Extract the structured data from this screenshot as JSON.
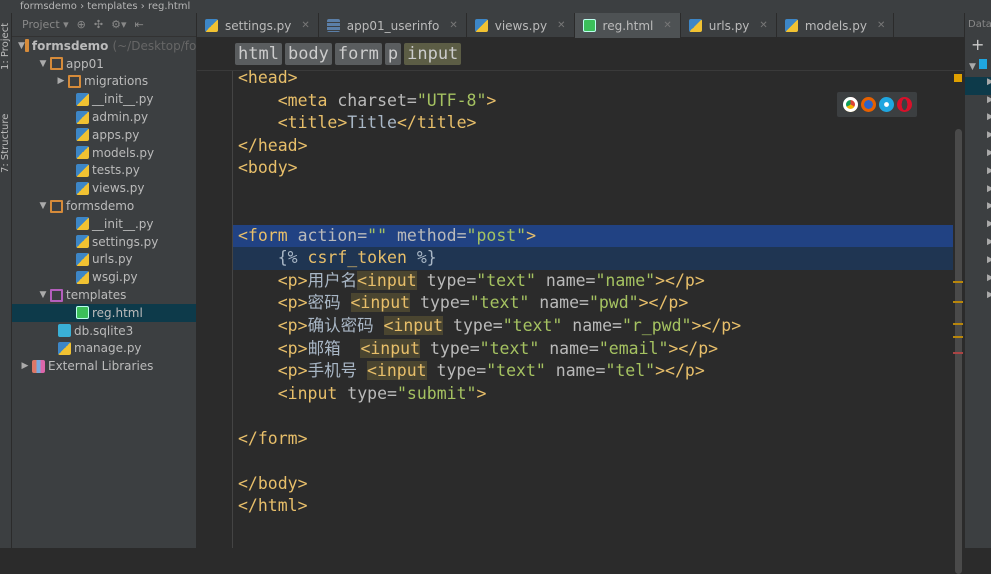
{
  "titlebar": {
    "crumbs": [
      "formsdemo",
      "templates",
      "reg.html"
    ]
  },
  "toolwindows": {
    "project": "1: Project",
    "structure": "7: Structure"
  },
  "project_panel": {
    "title": "Project",
    "tree": [
      {
        "label": "formsdemo",
        "hint": "(~/Desktop/fo",
        "type": "folder",
        "depth": 0,
        "expanded": true
      },
      {
        "label": "app01",
        "type": "folder",
        "depth": 1,
        "expanded": true
      },
      {
        "label": "migrations",
        "type": "folder",
        "depth": 2,
        "expanded": false
      },
      {
        "label": "__init__.py",
        "type": "py",
        "depth": 2
      },
      {
        "label": "admin.py",
        "type": "py",
        "depth": 2
      },
      {
        "label": "apps.py",
        "type": "py",
        "depth": 2
      },
      {
        "label": "models.py",
        "type": "py",
        "depth": 2
      },
      {
        "label": "tests.py",
        "type": "py",
        "depth": 2
      },
      {
        "label": "views.py",
        "type": "py",
        "depth": 2
      },
      {
        "label": "formsdemo",
        "type": "folder",
        "depth": 1,
        "expanded": true
      },
      {
        "label": "__init__.py",
        "type": "py",
        "depth": 2
      },
      {
        "label": "settings.py",
        "type": "py",
        "depth": 2
      },
      {
        "label": "urls.py",
        "type": "py",
        "depth": 2
      },
      {
        "label": "wsgi.py",
        "type": "py",
        "depth": 2
      },
      {
        "label": "templates",
        "type": "tplfolder",
        "depth": 1,
        "expanded": true
      },
      {
        "label": "reg.html",
        "type": "html",
        "depth": 2,
        "selected": true
      },
      {
        "label": "db.sqlite3",
        "type": "db",
        "depth": 1
      },
      {
        "label": "manage.py",
        "type": "py",
        "depth": 1
      },
      {
        "label": "External Libraries",
        "type": "lib",
        "depth": 0,
        "expanded": false
      }
    ]
  },
  "tabs": [
    {
      "label": "settings.py",
      "icon": "python-file-icon"
    },
    {
      "label": "app01_userinfo",
      "icon": "table-icon"
    },
    {
      "label": "views.py",
      "icon": "python-file-icon"
    },
    {
      "label": "reg.html",
      "icon": "html-file-icon",
      "active": true
    },
    {
      "label": "urls.py",
      "icon": "python-file-icon"
    },
    {
      "label": "models.py",
      "icon": "python-file-icon"
    }
  ],
  "breadcrumb": [
    "html",
    "body",
    "form",
    "p",
    "input"
  ],
  "data_panel": {
    "title": "Data"
  },
  "colors": {
    "tag": "#e8bf6a",
    "attr": "#bababa",
    "value": "#a5c261",
    "background": "#2b2b2b",
    "selection": "#214283"
  },
  "code_lines": [
    [
      [
        "t",
        "<head>"
      ]
    ],
    [
      [
        "x",
        "    "
      ],
      [
        "t",
        "<meta "
      ],
      [
        "a",
        "charset="
      ],
      [
        "v",
        "\"UTF-8\""
      ],
      [
        "t",
        ">"
      ]
    ],
    [
      [
        "x",
        "    "
      ],
      [
        "t",
        "<title>"
      ],
      [
        "x",
        "Title"
      ],
      [
        "t",
        "</title>"
      ]
    ],
    [
      [
        "t",
        "</head>"
      ]
    ],
    [
      [
        "t",
        "<body>"
      ]
    ],
    [],
    [],
    [
      [
        "t",
        "<form "
      ],
      [
        "a",
        "action="
      ],
      [
        "v",
        "\"\""
      ],
      [
        "a",
        " method="
      ],
      [
        "v",
        "\"post\""
      ],
      [
        "t",
        ">"
      ]
    ],
    [
      [
        "x",
        "    {% "
      ],
      [
        "t",
        "csrf_token"
      ],
      [
        "x",
        " %}"
      ]
    ],
    [
      [
        "x",
        "    "
      ],
      [
        "t",
        "<p>"
      ],
      [
        "x",
        "用户名"
      ],
      [
        "tb",
        "<input"
      ],
      [
        "a",
        " type="
      ],
      [
        "v",
        "\"text\""
      ],
      [
        "a",
        " name="
      ],
      [
        "v",
        "\"name\""
      ],
      [
        "t",
        "></p>"
      ]
    ],
    [
      [
        "x",
        "    "
      ],
      [
        "t",
        "<p>"
      ],
      [
        "x",
        "密码 "
      ],
      [
        "tb",
        "<input"
      ],
      [
        "a",
        " type="
      ],
      [
        "v",
        "\"text\""
      ],
      [
        "a",
        " name="
      ],
      [
        "v",
        "\"pwd\""
      ],
      [
        "t",
        "></p>"
      ]
    ],
    [
      [
        "x",
        "    "
      ],
      [
        "t",
        "<p>"
      ],
      [
        "x",
        "确认密码 "
      ],
      [
        "tb",
        "<input"
      ],
      [
        "a",
        " type="
      ],
      [
        "v",
        "\"text\""
      ],
      [
        "a",
        " name="
      ],
      [
        "v",
        "\"r_pwd\""
      ],
      [
        "t",
        "></p>"
      ]
    ],
    [
      [
        "x",
        "    "
      ],
      [
        "t",
        "<p>"
      ],
      [
        "x",
        "邮箱  "
      ],
      [
        "tb",
        "<input"
      ],
      [
        "a",
        " type="
      ],
      [
        "v",
        "\"text\""
      ],
      [
        "a",
        " name="
      ],
      [
        "v",
        "\"email\""
      ],
      [
        "t",
        "></p>"
      ]
    ],
    [
      [
        "x",
        "    "
      ],
      [
        "t",
        "<p>"
      ],
      [
        "x",
        "手机号 "
      ],
      [
        "tb",
        "<input"
      ],
      [
        "a",
        " type="
      ],
      [
        "v",
        "\"text\""
      ],
      [
        "a",
        " name="
      ],
      [
        "v",
        "\"tel\""
      ],
      [
        "t",
        "></p>"
      ]
    ],
    [
      [
        "x",
        "    "
      ],
      [
        "t",
        "<input"
      ],
      [
        "a",
        " type="
      ],
      [
        "v",
        "\"submit\""
      ],
      [
        "t",
        ">"
      ]
    ],
    [],
    [
      [
        "t",
        "</form>"
      ]
    ],
    [],
    [
      [
        "t",
        "</body>"
      ]
    ],
    [
      [
        "t",
        "</html>"
      ]
    ]
  ],
  "browser_icons": [
    "chrome-icon",
    "firefox-icon",
    "safari-icon",
    "opera-icon"
  ]
}
